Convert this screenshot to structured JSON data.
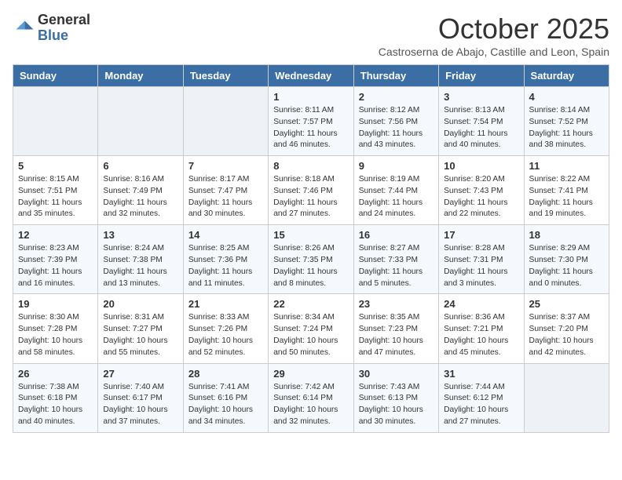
{
  "header": {
    "logo_general": "General",
    "logo_blue": "Blue",
    "month_title": "October 2025",
    "subtitle": "Castroserna de Abajo, Castille and Leon, Spain"
  },
  "days_of_week": [
    "Sunday",
    "Monday",
    "Tuesday",
    "Wednesday",
    "Thursday",
    "Friday",
    "Saturday"
  ],
  "weeks": [
    [
      {
        "day": "",
        "info": ""
      },
      {
        "day": "",
        "info": ""
      },
      {
        "day": "",
        "info": ""
      },
      {
        "day": "1",
        "info": "Sunrise: 8:11 AM\nSunset: 7:57 PM\nDaylight: 11 hours and 46 minutes."
      },
      {
        "day": "2",
        "info": "Sunrise: 8:12 AM\nSunset: 7:56 PM\nDaylight: 11 hours and 43 minutes."
      },
      {
        "day": "3",
        "info": "Sunrise: 8:13 AM\nSunset: 7:54 PM\nDaylight: 11 hours and 40 minutes."
      },
      {
        "day": "4",
        "info": "Sunrise: 8:14 AM\nSunset: 7:52 PM\nDaylight: 11 hours and 38 minutes."
      }
    ],
    [
      {
        "day": "5",
        "info": "Sunrise: 8:15 AM\nSunset: 7:51 PM\nDaylight: 11 hours and 35 minutes."
      },
      {
        "day": "6",
        "info": "Sunrise: 8:16 AM\nSunset: 7:49 PM\nDaylight: 11 hours and 32 minutes."
      },
      {
        "day": "7",
        "info": "Sunrise: 8:17 AM\nSunset: 7:47 PM\nDaylight: 11 hours and 30 minutes."
      },
      {
        "day": "8",
        "info": "Sunrise: 8:18 AM\nSunset: 7:46 PM\nDaylight: 11 hours and 27 minutes."
      },
      {
        "day": "9",
        "info": "Sunrise: 8:19 AM\nSunset: 7:44 PM\nDaylight: 11 hours and 24 minutes."
      },
      {
        "day": "10",
        "info": "Sunrise: 8:20 AM\nSunset: 7:43 PM\nDaylight: 11 hours and 22 minutes."
      },
      {
        "day": "11",
        "info": "Sunrise: 8:22 AM\nSunset: 7:41 PM\nDaylight: 11 hours and 19 minutes."
      }
    ],
    [
      {
        "day": "12",
        "info": "Sunrise: 8:23 AM\nSunset: 7:39 PM\nDaylight: 11 hours and 16 minutes."
      },
      {
        "day": "13",
        "info": "Sunrise: 8:24 AM\nSunset: 7:38 PM\nDaylight: 11 hours and 13 minutes."
      },
      {
        "day": "14",
        "info": "Sunrise: 8:25 AM\nSunset: 7:36 PM\nDaylight: 11 hours and 11 minutes."
      },
      {
        "day": "15",
        "info": "Sunrise: 8:26 AM\nSunset: 7:35 PM\nDaylight: 11 hours and 8 minutes."
      },
      {
        "day": "16",
        "info": "Sunrise: 8:27 AM\nSunset: 7:33 PM\nDaylight: 11 hours and 5 minutes."
      },
      {
        "day": "17",
        "info": "Sunrise: 8:28 AM\nSunset: 7:31 PM\nDaylight: 11 hours and 3 minutes."
      },
      {
        "day": "18",
        "info": "Sunrise: 8:29 AM\nSunset: 7:30 PM\nDaylight: 11 hours and 0 minutes."
      }
    ],
    [
      {
        "day": "19",
        "info": "Sunrise: 8:30 AM\nSunset: 7:28 PM\nDaylight: 10 hours and 58 minutes."
      },
      {
        "day": "20",
        "info": "Sunrise: 8:31 AM\nSunset: 7:27 PM\nDaylight: 10 hours and 55 minutes."
      },
      {
        "day": "21",
        "info": "Sunrise: 8:33 AM\nSunset: 7:26 PM\nDaylight: 10 hours and 52 minutes."
      },
      {
        "day": "22",
        "info": "Sunrise: 8:34 AM\nSunset: 7:24 PM\nDaylight: 10 hours and 50 minutes."
      },
      {
        "day": "23",
        "info": "Sunrise: 8:35 AM\nSunset: 7:23 PM\nDaylight: 10 hours and 47 minutes."
      },
      {
        "day": "24",
        "info": "Sunrise: 8:36 AM\nSunset: 7:21 PM\nDaylight: 10 hours and 45 minutes."
      },
      {
        "day": "25",
        "info": "Sunrise: 8:37 AM\nSunset: 7:20 PM\nDaylight: 10 hours and 42 minutes."
      }
    ],
    [
      {
        "day": "26",
        "info": "Sunrise: 7:38 AM\nSunset: 6:18 PM\nDaylight: 10 hours and 40 minutes."
      },
      {
        "day": "27",
        "info": "Sunrise: 7:40 AM\nSunset: 6:17 PM\nDaylight: 10 hours and 37 minutes."
      },
      {
        "day": "28",
        "info": "Sunrise: 7:41 AM\nSunset: 6:16 PM\nDaylight: 10 hours and 34 minutes."
      },
      {
        "day": "29",
        "info": "Sunrise: 7:42 AM\nSunset: 6:14 PM\nDaylight: 10 hours and 32 minutes."
      },
      {
        "day": "30",
        "info": "Sunrise: 7:43 AM\nSunset: 6:13 PM\nDaylight: 10 hours and 30 minutes."
      },
      {
        "day": "31",
        "info": "Sunrise: 7:44 AM\nSunset: 6:12 PM\nDaylight: 10 hours and 27 minutes."
      },
      {
        "day": "",
        "info": ""
      }
    ]
  ]
}
